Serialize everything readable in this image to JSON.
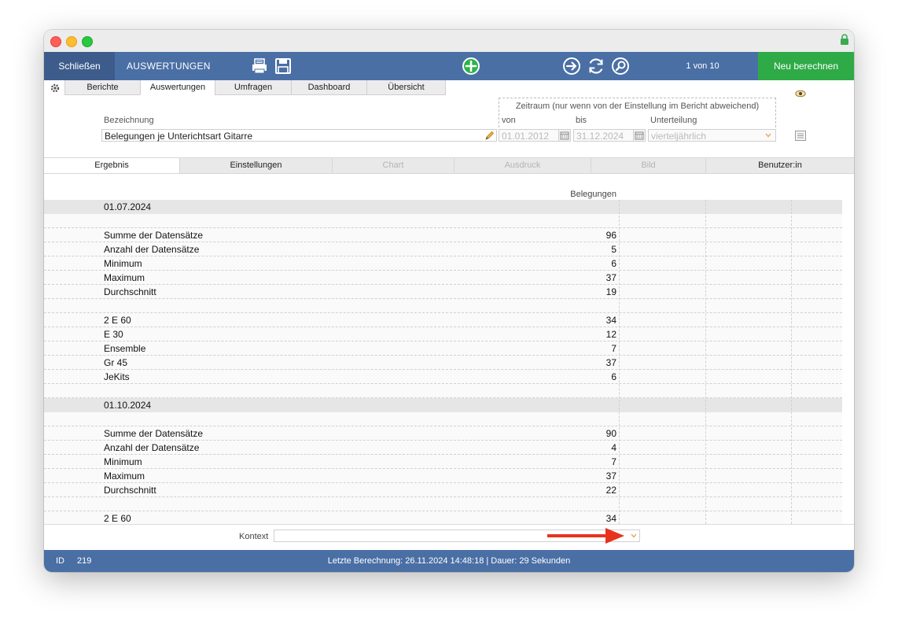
{
  "toolbar": {
    "close_label": "Schließen",
    "title": "AUSWERTUNGEN",
    "counter": "1 von 10",
    "recalc_label": "Neu berechnen"
  },
  "tabs_top": [
    "Berichte",
    "Auswertungen",
    "Umfragen",
    "Dashboard",
    "Übersicht"
  ],
  "header": {
    "bezeichnung_label": "Bezeichnung",
    "bezeichnung_value": "Belegungen je Unterichtsart Gitarre",
    "zeitraum_label": "Zeitraum (nur wenn von der Einstellung im Bericht abweichend)",
    "von_label": "von",
    "von_value": "01.01.2012",
    "bis_label": "bis",
    "bis_value": "31.12.2024",
    "unterteilung_label": "Unterteilung",
    "unterteilung_value": "vierteljährlich"
  },
  "tabs_sub": [
    "Ergebnis",
    "Einstellungen",
    "Chart",
    "Ausdruck",
    "Bild",
    "Benutzer:in"
  ],
  "result": {
    "column_header": "Belegungen",
    "rows": [
      {
        "label": "01.07.2024",
        "value": "",
        "group": true
      },
      {
        "label": "",
        "value": ""
      },
      {
        "label": "Summe der Datensätze",
        "value": "96"
      },
      {
        "label": "Anzahl der Datensätze",
        "value": "5"
      },
      {
        "label": "Minimum",
        "value": "6"
      },
      {
        "label": "Maximum",
        "value": "37"
      },
      {
        "label": "Durchschnitt",
        "value": "19"
      },
      {
        "label": "",
        "value": ""
      },
      {
        "label": "2 E 60",
        "value": "34"
      },
      {
        "label": "E 30",
        "value": "12"
      },
      {
        "label": "Ensemble",
        "value": "7"
      },
      {
        "label": "Gr 45",
        "value": "37"
      },
      {
        "label": "JeKits",
        "value": "6"
      },
      {
        "label": "",
        "value": ""
      },
      {
        "label": "01.10.2024",
        "value": "",
        "group": true
      },
      {
        "label": "",
        "value": ""
      },
      {
        "label": "Summe der Datensätze",
        "value": "90"
      },
      {
        "label": "Anzahl der Datensätze",
        "value": "4"
      },
      {
        "label": "Minimum",
        "value": "7"
      },
      {
        "label": "Maximum",
        "value": "37"
      },
      {
        "label": "Durchschnitt",
        "value": "22"
      },
      {
        "label": "",
        "value": ""
      },
      {
        "label": "2 E 60",
        "value": "34"
      }
    ]
  },
  "context": {
    "label": "Kontext",
    "value": ""
  },
  "status": {
    "id_label": "ID",
    "id_value": "219",
    "text": "Letzte Berechnung: 26.11.2024 14:48:18  |  Dauer: 29 Sekunden"
  },
  "colors": {
    "toolbar": "#4a6fa5",
    "close_button": "#3d5c8c",
    "recalc_button": "#2eaa47",
    "group_row": "#e6e6e6",
    "annotation_arrow": "#e8321e"
  }
}
